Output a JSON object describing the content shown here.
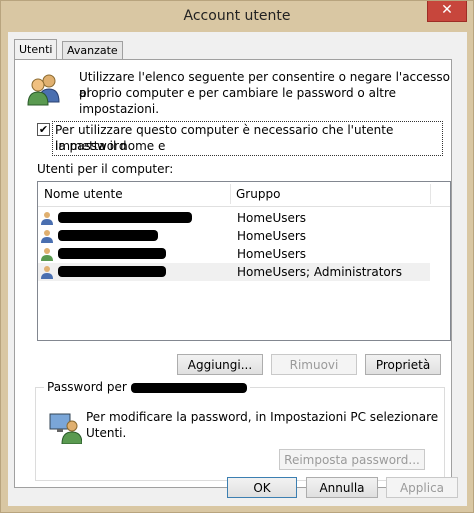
{
  "window": {
    "title": "Account utente",
    "close_glyph": "✕"
  },
  "tabs": [
    {
      "label": "Utenti",
      "active": true
    },
    {
      "label": "Avanzate",
      "active": false
    }
  ],
  "intro_text_line1": "Utilizzare l'elenco seguente per consentire o negare l'accesso al",
  "intro_text_line2": "proprio computer e per cambiare le password o altre impostazioni.",
  "require_password": {
    "checked": true,
    "mark": "✔",
    "label_line1": "Per utilizzare questo computer è necessario che l'utente immetta il nome e",
    "label_line2": "la password"
  },
  "users_label": "Utenti per il computer:",
  "table": {
    "headers": [
      "Nome utente",
      "Gruppo"
    ],
    "rows": [
      {
        "group": "HomeUsers"
      },
      {
        "group": "HomeUsers"
      },
      {
        "group": "HomeUsers"
      },
      {
        "group": "HomeUsers; Administrators"
      }
    ]
  },
  "buttons": {
    "add": "Aggiungi...",
    "remove": "Rimuovi",
    "properties": "Proprietà"
  },
  "password_group": {
    "title": "Password per",
    "text_line1": "Per modificare la password, in Impostazioni PC selezionare",
    "text_line2": "Utenti.",
    "reset_button": "Reimposta password..."
  },
  "footer": {
    "ok": "OK",
    "cancel": "Annulla",
    "apply": "Applica"
  },
  "colors": {
    "frame": "#d9c7a3",
    "close": "#c7463c",
    "client": "#f0f0f0",
    "selected_row": "#f0f0f0"
  }
}
